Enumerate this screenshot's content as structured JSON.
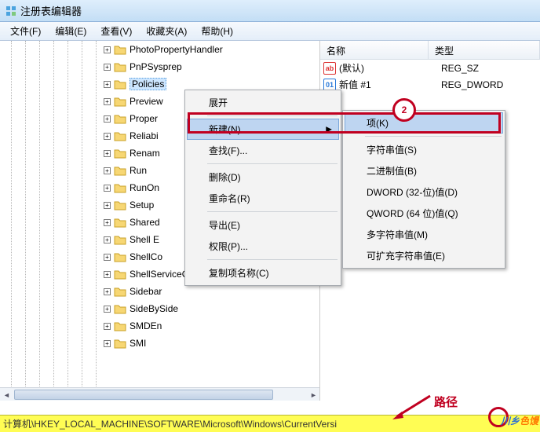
{
  "window": {
    "title": "注册表编辑器"
  },
  "menubar": {
    "file": "文件(F)",
    "edit": "编辑(E)",
    "view": "查看(V)",
    "favorites": "收藏夹(A)",
    "help": "帮助(H)"
  },
  "tree": {
    "nodes": [
      "PhotoPropertyHandler",
      "PnPSysprep",
      "Policies",
      "Preview",
      "Proper",
      "Reliabi",
      "Renam",
      "Run",
      "RunOn",
      "Setup",
      "Shared",
      "Shell E",
      "ShellCo",
      "ShellServiceObjectDelayLoad",
      "Sidebar",
      "SideBySide",
      "SMDEn",
      "SMI"
    ],
    "selected_index": 2
  },
  "list": {
    "col_name": "名称",
    "col_type": "类型",
    "rows": [
      {
        "icon": "ab",
        "icon_color": "#d33",
        "name": "(默认)",
        "type": "REG_SZ"
      },
      {
        "icon": "01",
        "icon_color": "#2878d8",
        "name": "新值 #1",
        "type": "REG_DWORD"
      }
    ]
  },
  "ctx1": {
    "expand": "展开",
    "new": "新建(N)",
    "find": "查找(F)...",
    "delete": "删除(D)",
    "rename": "重命名(R)",
    "export": "导出(E)",
    "perm": "权限(P)...",
    "copykey": "复制项名称(C)"
  },
  "ctx2": {
    "key": "项(K)",
    "string": "字符串值(S)",
    "binary": "二进制值(B)",
    "dword": "DWORD (32-位)值(D)",
    "qword": "QWORD (64 位)值(Q)",
    "multi": "多字符串值(M)",
    "expand": "可扩充字符串值(E)"
  },
  "annotations": {
    "step": "2",
    "path_label": "路径"
  },
  "status": {
    "path": "计算机\\HKEY_LOCAL_MACHINE\\SOFTWARE\\Microsoft\\Windows\\CurrentVersi"
  },
  "watermark": {
    "a": "川乡",
    "b": "色馒"
  }
}
